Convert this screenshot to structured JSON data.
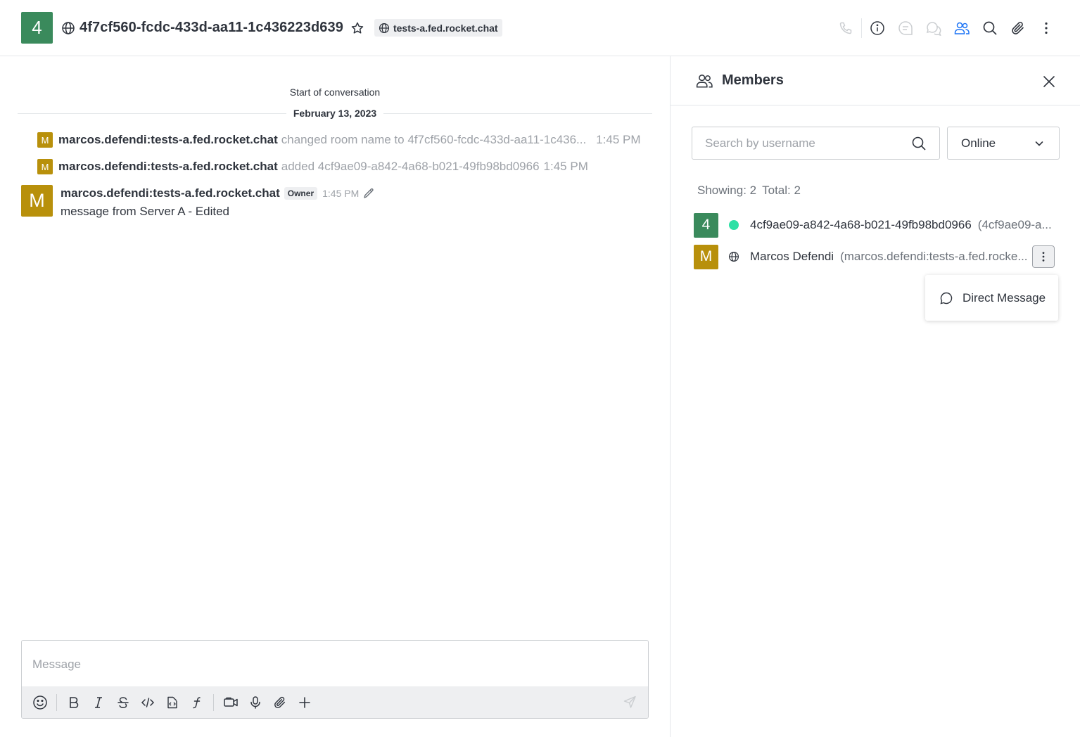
{
  "header": {
    "room_avatar_letter": "4",
    "room_name": "4f7cf560-fcdc-433d-aa11-1c436223d639",
    "server_tag": "tests-a.fed.rocket.chat",
    "avatar_color": "#3a8a5c",
    "toolbar_icons": [
      "phone-icon",
      "info-icon",
      "threads-icon",
      "discussions-icon",
      "members-icon",
      "search-icon",
      "attachment-icon",
      "kebab-menu-icon"
    ],
    "active_toolbar_color": "#1d74f5"
  },
  "chat": {
    "start_label": "Start of conversation",
    "date_label": "February 13, 2023",
    "system_messages": [
      {
        "avatar_letter": "M",
        "user": "marcos.defendi:tests-a.fed.rocket.chat",
        "text": "changed room name to 4f7cf560-fcdc-433d-aa11-1c436...",
        "time": "1:45 PM"
      },
      {
        "avatar_letter": "M",
        "user": "marcos.defendi:tests-a.fed.rocket.chat",
        "text": "added 4cf9ae09-a842-4a68-b021-49fb98bd0966",
        "time": "1:45 PM"
      }
    ],
    "message": {
      "avatar_letter": "M",
      "user": "marcos.defendi:tests-a.fed.rocket.chat",
      "role": "Owner",
      "time": "1:45 PM",
      "text": "message from Server A - Edited"
    },
    "user_avatar_color": "#b8900b"
  },
  "composer": {
    "placeholder": "Message",
    "tools": [
      "emoji-icon",
      "bold-icon",
      "italic-icon",
      "strikethrough-icon",
      "inline-code-icon",
      "code-block-icon",
      "katex-icon",
      "video-message-icon",
      "audio-message-icon",
      "attachment-icon",
      "plus-icon",
      "send-icon"
    ]
  },
  "members_panel": {
    "title": "Members",
    "search_placeholder": "Search by username",
    "status_filter": "Online",
    "showing_label": "Showing: 2",
    "total_label": "Total: 2",
    "members": [
      {
        "avatar_letter": "4",
        "avatar_color": "#3a8a5c",
        "status": "online",
        "name": "4cf9ae09-a842-4a68-b021-49fb98bd0966",
        "username": "(4cf9ae09-a..."
      },
      {
        "avatar_letter": "M",
        "avatar_color": "#b8900b",
        "status": "federated",
        "name": "Marcos Defendi",
        "username": "(marcos.defendi:tests-a.fed.rocke..."
      }
    ],
    "menu_item": "Direct Message",
    "online_color": "#2de0a5"
  }
}
